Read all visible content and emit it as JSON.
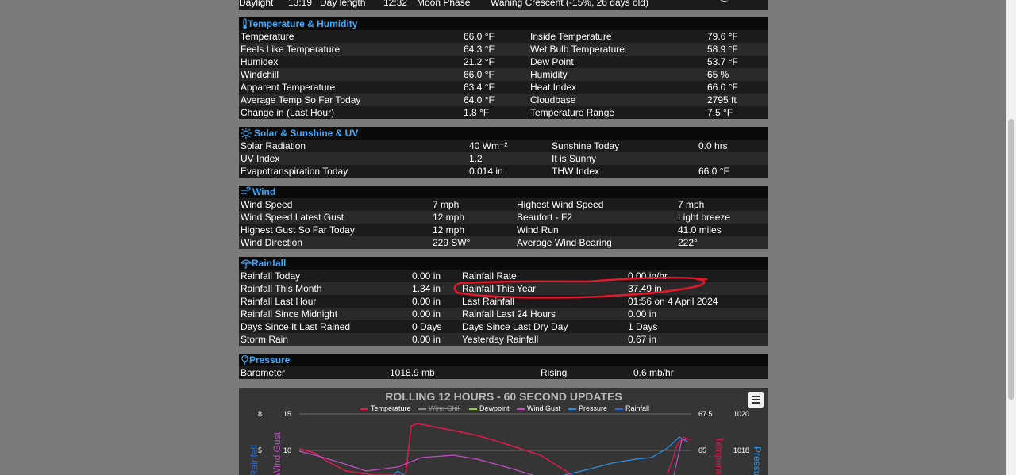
{
  "top_row": {
    "label1": "Daylight",
    "val1": "13:19",
    "label2": "Day length",
    "val2": "12:32",
    "label3": "Moon Phase",
    "val3": "Waning Crescent (-15%, 26 days old)"
  },
  "temperature": {
    "title": "Temperature & Humidity",
    "rows": [
      [
        "Temperature",
        "66.0  °F",
        "Inside Temperature",
        "79.6 °F"
      ],
      [
        "Feels Like Temperature",
        "64.3  °F",
        "Wet Bulb Temperature",
        "58.9 °F"
      ],
      [
        "Humidex",
        "21.2  °F",
        "Dew Point",
        "53.7 °F"
      ],
      [
        "Windchill",
        "66.0 °F",
        "Humidity",
        "65 %"
      ],
      [
        "Apparent Temperature",
        "63.4 °F",
        "Heat Index",
        "66.0 °F"
      ],
      [
        "Average Temp So Far Today",
        "64.0 °F",
        "Cloudbase",
        "2795 ft"
      ],
      [
        "Change in (Last Hour)",
        "1.8 °F",
        "Temperature Range",
        "7.5 °F"
      ]
    ]
  },
  "solar": {
    "title": "Solar & Sunshine & UV",
    "rows": [
      [
        "Solar Radiation",
        "40 Wm⁻²",
        "Sunshine Today",
        "0.0 hrs"
      ],
      [
        "UV Index",
        "1.2",
        "It is Sunny",
        ""
      ],
      [
        "Evapotranspiration Today",
        "0.014 in",
        "THW Index",
        "66.0 °F"
      ]
    ]
  },
  "wind": {
    "title": "Wind",
    "rows": [
      [
        "Wind Speed",
        "7 mph",
        "Highest Wind Speed",
        "7 mph"
      ],
      [
        "Wind Speed Latest Gust",
        "12 mph",
        "Beaufort - F2",
        "Light breeze"
      ],
      [
        "Highest Gust So Far Today",
        "12 mph",
        "Wind Run",
        "41.0 miles"
      ],
      [
        "Wind Direction",
        "229 SW°",
        "Average Wind Bearing",
        "222°"
      ]
    ]
  },
  "rainfall": {
    "title": "Rainfall",
    "rows": [
      [
        "Rainfall Today",
        "0.00 in",
        "Rainfall Rate",
        "0.00 in/hr"
      ],
      [
        "Rainfall This Month",
        "1.34 in",
        "Rainfall This Year",
        "37.49 in"
      ],
      [
        "Rainfall Last Hour",
        "0.00 in",
        "Last Rainfall",
        "01:56 on 4 April 2024"
      ],
      [
        "Rainfall Since Midnight",
        "0.00 in",
        "Rainfall Last 24 Hours",
        "0.00 in"
      ],
      [
        "Days Since It Last Rained",
        "0 Days",
        "Days Since Last Dry Day",
        "1 Days"
      ],
      [
        "Storm Rain",
        "0.00 in",
        "Yesterday Rainfall",
        "0.67 in"
      ]
    ]
  },
  "pressure": {
    "title": "Pressure",
    "rows": [
      [
        "Barometer",
        "1018.9 mb",
        "Rising",
        "0.6 mb/hr"
      ]
    ]
  },
  "chart": {
    "title": "ROLLING 12 HOURS - 60 SECOND UPDATES",
    "legend": [
      "Temperature",
      "Wind Chill",
      "Dewpoint",
      "Wind Gust",
      "Pressure",
      "Rainfall"
    ],
    "legend_colors": [
      "#e0194e",
      "#8a8a8a",
      "#9acd32",
      "#c04fc0",
      "#2d8fe0",
      "#2d6bd6"
    ],
    "left_ticks_rain": [
      "8",
      "5"
    ],
    "left_ticks_gust": [
      "15",
      "10"
    ],
    "right_ticks_temp": [
      "67.5",
      "65"
    ],
    "right_ticks_pres": [
      "1020",
      "1018"
    ],
    "axis_titles": {
      "rain": "Rainfall",
      "gust": "Wind Gust",
      "temp": "Temperature",
      "pres": "Pressure"
    }
  },
  "annotation": {
    "color": "#e0192c"
  }
}
